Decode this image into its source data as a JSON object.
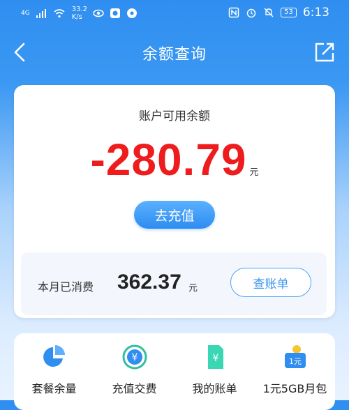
{
  "status_bar": {
    "network": "4G",
    "speed_value": "33.2",
    "speed_unit": "K/s",
    "battery": "53",
    "time": "6:13"
  },
  "nav": {
    "title": "余额查询",
    "icons": [
      "back-icon",
      "share-icon"
    ]
  },
  "balance": {
    "label": "账户可用余额",
    "amount": "-280.79",
    "unit": "元",
    "recharge_label": "去充值"
  },
  "month_spend": {
    "label": "本月已消费",
    "amount": "362.37",
    "unit": "元",
    "bill_button": "查账单"
  },
  "services": [
    {
      "label": "套餐余量",
      "icon": "pie-chart-icon"
    },
    {
      "label": "充值交费",
      "icon": "yen-refresh-icon"
    },
    {
      "label": "我的账单",
      "icon": "bill-icon"
    },
    {
      "label": "1元5GB月包",
      "icon": "data-pack-icon"
    }
  ],
  "colors": {
    "accent": "#2f8ef0",
    "negative": "#ee1c1c"
  }
}
